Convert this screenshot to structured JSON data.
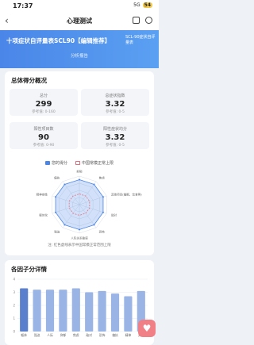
{
  "status_bar": {
    "time": "17:37",
    "network": "5G",
    "battery": "54"
  },
  "nav": {
    "title": "心理测试",
    "back_icon": "chevron-left-icon"
  },
  "hero": {
    "title": "十项症状自评量表SCL90【编辑推荐】",
    "subtitle": "分析报告",
    "tag": "SCL-90症状自评量表"
  },
  "overview": {
    "heading": "总体得分概况",
    "stats": [
      {
        "label": "总分",
        "value": "299",
        "ref": "参考值: 0-160"
      },
      {
        "label": "总症状指数",
        "value": "3.32",
        "ref": "参考值: 0-5"
      },
      {
        "label": "阳性项目数",
        "value": "90",
        "ref": "参考值: 0-90"
      },
      {
        "label": "阳性症状均分",
        "value": "3.32",
        "ref": "参考值: 0-5"
      }
    ],
    "note": "注: 红色虚线表示中国常模正常范围上限"
  },
  "chart_data": [
    {
      "type": "radar",
      "series": [
        {
          "name": "您的得分",
          "values": [
            3.5,
            3.5,
            3.5,
            3.5,
            3.5,
            3.5,
            3.5,
            3.5,
            3.5,
            3.5
          ]
        },
        {
          "name": "中国常模正常上限",
          "values": [
            1.5,
            1.5,
            1.5,
            1.5,
            1.5,
            1.5,
            1.5,
            1.5,
            1.5,
            1.5
          ]
        }
      ],
      "categories": [
        "抑郁",
        "焦虑",
        "其他项目(睡眠、饮食等)",
        "敌对",
        "恐怖",
        "人际关系敏感",
        "强迫",
        "躯体化",
        "精神病性",
        "偏执"
      ],
      "ylim": [
        0,
        4
      ],
      "colors": {
        "user": "#4a86e8",
        "norm": "#e36d7d"
      }
    },
    {
      "type": "bar",
      "categories": [
        "躯体",
        "强迫",
        "人际",
        "抑郁",
        "焦虑",
        "敌对",
        "恐怖",
        "偏执",
        "精神",
        "其他"
      ],
      "values": [
        3.3,
        3.2,
        3.2,
        3.2,
        3.3,
        3.0,
        3.1,
        2.9,
        2.7,
        3.1
      ],
      "ylim": [
        0,
        4
      ],
      "yticks": [
        "4",
        "3",
        "2",
        "1",
        "0"
      ],
      "colors": {
        "bar": "#9bb4e6",
        "bar_dark": "#5a7fcc"
      }
    }
  ],
  "factors": {
    "heading": "各因子分详情"
  },
  "fab": {
    "icon": "heart-icon"
  }
}
